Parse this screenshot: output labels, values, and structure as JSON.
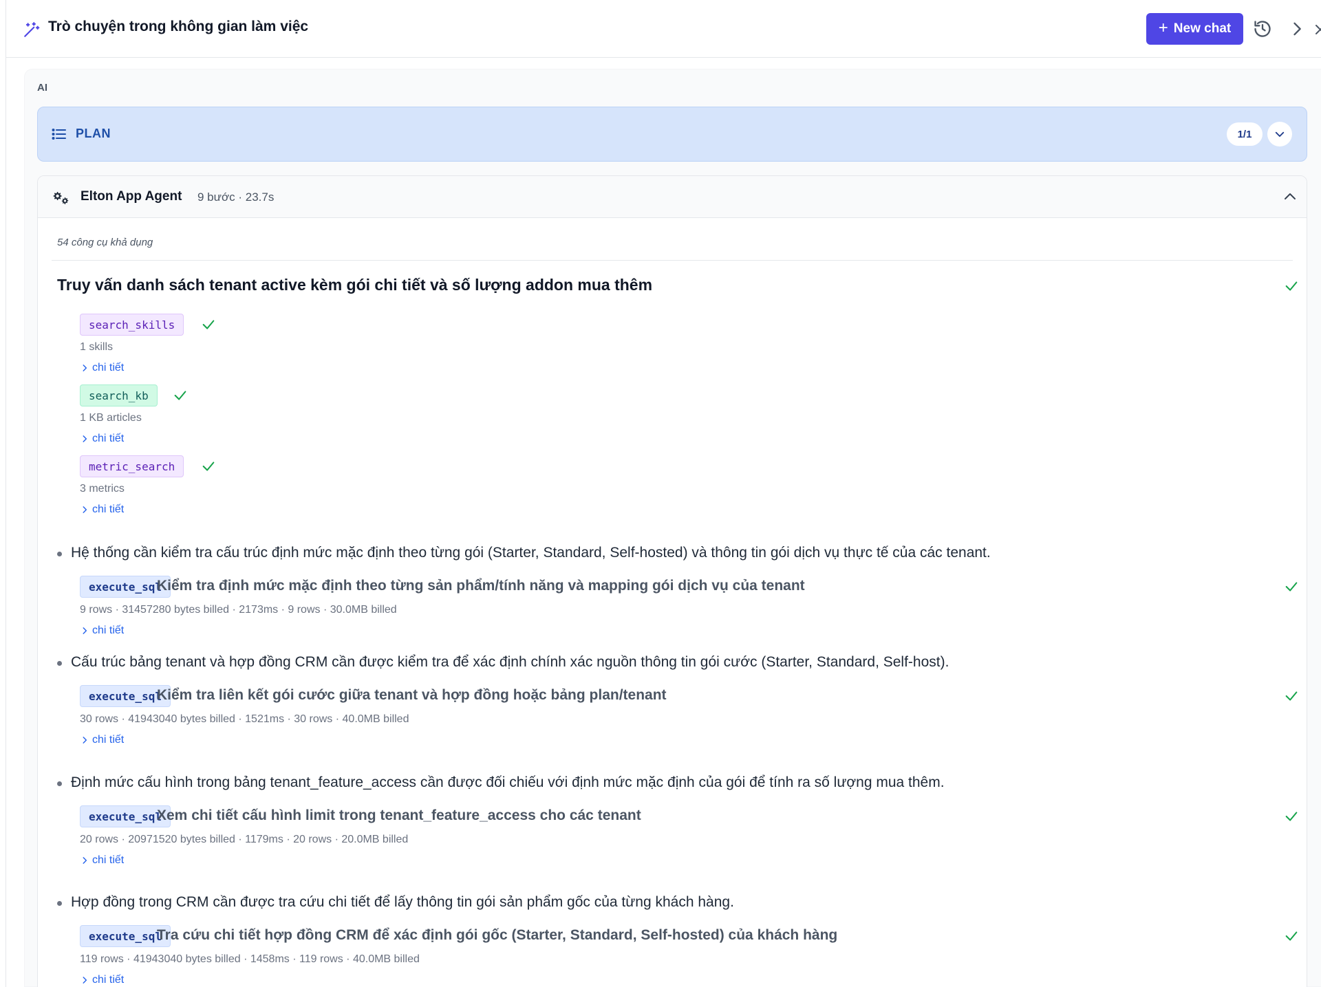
{
  "header": {
    "title": "Trò chuyện trong không gian làm việc",
    "new_chat_label": "New chat"
  },
  "role_label": "AI",
  "plan": {
    "label": "PLAN",
    "count": "1/1"
  },
  "agent": {
    "name": "Elton App Agent",
    "meta": "9 bước · 23.7s",
    "tools_available": "54 công cụ khả dụng"
  },
  "task": {
    "title": "Truy vấn danh sách tenant active kèm gói chi tiết và số lượng addon mua thêm"
  },
  "detail_label": "chi tiết",
  "tool_calls": [
    {
      "name": "search_skills",
      "result": "1 skills",
      "color": "purple"
    },
    {
      "name": "search_kb",
      "result": "1 KB articles",
      "color": "green"
    },
    {
      "name": "metric_search",
      "result": "3 metrics",
      "color": "purple"
    }
  ],
  "steps": [
    {
      "text": "Hệ thống cần kiểm tra cấu trúc định mức mặc định theo từng gói (Starter, Standard, Self-hosted) và thông tin gói dịch vụ thực tế của các tenant.",
      "tool": "execute_sql",
      "desc": "Kiểm tra định mức mặc định theo từng sản phẩm/tính năng và mapping gói dịch vụ của tenant",
      "result": "9 rows · 31457280 bytes billed · 2173ms · 9 rows · 30.0MB billed"
    },
    {
      "text": "Cấu trúc bảng tenant và hợp đồng CRM cần được kiểm tra để xác định chính xác nguồn thông tin gói cước (Starter, Standard, Self-host).",
      "tool": "execute_sql",
      "desc": "Kiểm tra liên kết gói cước giữa tenant và hợp đồng hoặc bảng plan/tenant",
      "result": "30 rows · 41943040 bytes billed · 1521ms · 30 rows · 40.0MB billed"
    },
    {
      "text": "Định mức cấu hình trong bảng tenant_feature_access cần được đối chiếu với định mức mặc định của gói để tính ra số lượng mua thêm.",
      "tool": "execute_sql",
      "desc": "Xem chi tiết cấu hình limit trong tenant_feature_access cho các tenant",
      "result": "20 rows · 20971520 bytes billed · 1179ms · 20 rows · 20.0MB billed"
    },
    {
      "text": "Hợp đồng trong CRM cần được tra cứu chi tiết để lấy thông tin gói sản phẩm gốc của từng khách hàng.",
      "tool": "execute_sql",
      "desc": "Tra cứu chi tiết hợp đồng CRM để xác định gói gốc (Starter, Standard, Self-hosted) của khách hàng",
      "result": "119 rows · 41943040 bytes billed · 1458ms · 119 rows · 40.0MB billed"
    }
  ],
  "colors": {
    "accent": "#4f46e5",
    "plan_bg": "#d6e4fb",
    "success": "#16a34a",
    "link": "#2563eb"
  }
}
